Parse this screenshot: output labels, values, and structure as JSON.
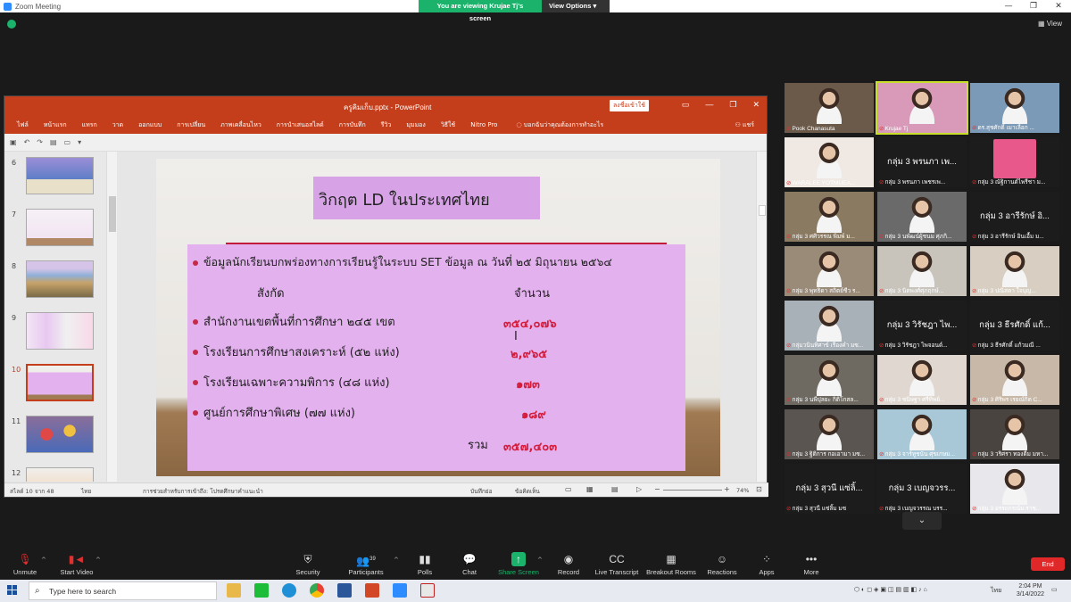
{
  "window": {
    "title": "Zoom Meeting",
    "controls": [
      "—",
      "❐",
      "✕"
    ],
    "viewing_banner": "You are viewing Krujae Tj's screen",
    "view_options": "View Options ▾",
    "view_button": "View"
  },
  "powerpoint": {
    "filename": "ครูคิมเก็บ.pptx  -  PowerPoint",
    "signin": "ลงชื่อเข้าใช้",
    "ribbon_tabs": [
      "ไฟล์",
      "หน้าแรก",
      "แทรก",
      "วาด",
      "ออกแบบ",
      "การเปลี่ยน",
      "ภาพเคลื่อนไหว",
      "การนำเสนอสไลด์",
      "การบันทึก",
      "รีวิว",
      "มุมมอง",
      "วิธีใช้",
      "Nitro Pro"
    ],
    "tell_me": "บอกฉันว่าคุณต้องการทำอะไร",
    "share": "แชร์",
    "thumbnails": [
      {
        "num": "6",
        "active": false
      },
      {
        "num": "7",
        "active": false
      },
      {
        "num": "8",
        "active": false
      },
      {
        "num": "9",
        "active": false
      },
      {
        "num": "10",
        "active": true
      },
      {
        "num": "11",
        "active": false
      },
      {
        "num": "12",
        "active": false
      }
    ],
    "slide": {
      "title": "วิกฤต LD ในประเทศไทย",
      "intro": "ข้อมูลนักเรียนบกพร่องทางการเรียนรู้ในระบบ SET ข้อมูล ณ วันที่ ๒๕ มิถุนายน ๒๕๖๔",
      "col_affiliation": "สังกัด",
      "col_count": "จำนวน",
      "rows": [
        {
          "label": "สำนักงานเขตพื้นที่การศึกษา ๒๔๕ เขต",
          "value": "๓๕๔,๐๗๖"
        },
        {
          "label": "โรงเรียนการศึกษาสงเคราะห์ (๕๒ แห่ง)",
          "value": "๒,๙๖๕"
        },
        {
          "label": "โรงเรียนเฉพาะความพิการ (๔๘ แห่ง)",
          "value": "๑๗๓"
        },
        {
          "label": "ศูนย์การศึกษาพิเศษ (๗๗ แห่ง)",
          "value": "๑๘๙"
        }
      ],
      "total_label": "รวม",
      "total_value": "๓๕๗,๔๐๓"
    },
    "status": {
      "slide_of": "สไลด์ 10 จาก 48",
      "language": "ไทย",
      "accessibility": "การช่วยสำหรับการเข้าถึง: โปรดศึกษาคำแนะนำ",
      "notes": "บันทึกย่อ",
      "comments": "ข้อคิดเห็น",
      "zoom": "74%"
    }
  },
  "participants": [
    {
      "name": "Pook Chanasuta",
      "type": "video",
      "color": "#6b5a4a"
    },
    {
      "name": "Krujae Tj",
      "type": "video",
      "color": "#d89ab8",
      "speaking": true
    },
    {
      "name": "ดร.สุชศักดิ์ เมาเลือก ...",
      "type": "video",
      "color": "#7a9ab8"
    },
    {
      "name": "WARALEE YOTMUEA...",
      "type": "video",
      "color": "#efe8e3"
    },
    {
      "name": "กลุ่ม 3 พรนภา เพชรเพ...",
      "type": "name",
      "big": "กลุ่ม 3 พรนภา เพ..."
    },
    {
      "name": "กลุ่ม 3 ณัฐิกานต์ไพรีชา ม...",
      "type": "avatar",
      "color": "#e8588a"
    },
    {
      "name": "กลุ่ม 3 ศศิวรรณ พิมพ์ ม...",
      "type": "video",
      "color": "#8a7a62"
    },
    {
      "name": "กลุ่ม 3 นพัฒน์ผู้ชนม ศุภกิ...",
      "type": "video",
      "color": "#6a6a6a"
    },
    {
      "name": "กลุ่ม 3 อารีรักษ์ อินเอื้ม ม...",
      "type": "name",
      "big": "กลุ่ม 3 อารีรักษ์ อิ..."
    },
    {
      "name": "กลุ่ม 3 พุทธิดา สถิตย์ชีว ร...",
      "type": "video",
      "color": "#9a8a78"
    },
    {
      "name": "กลุ่ม 3 นิตพงศ์ศุภฤกษ์...",
      "type": "video",
      "color": "#c8c4bc"
    },
    {
      "name": "กลุ่ม 3 ปณิสตา ใจบุญ...",
      "type": "video",
      "color": "#d8cfc2"
    },
    {
      "name": "กลุ่มวนินทิศาข์ เรืองคำ มซ...",
      "type": "video",
      "color": "#a8b0b8"
    },
    {
      "name": "กลุ่ม 3 วิรัชฎา ไพจอนด์...",
      "type": "name",
      "big": "กลุ่ม 3 วิรัชฎา ไพ..."
    },
    {
      "name": "กลุ่ม 3 ธีรศักดิ์ แก้วมณี ...",
      "type": "name",
      "big": "กลุ่ม 3 ธีรศักดิ์ แก้..."
    },
    {
      "name": "กลุ่ม 3 นพีปุลยะ กิติโกสล...",
      "type": "video",
      "color": "#6e6a62"
    },
    {
      "name": "กลุ่ม 3 ชนิษฐา ศรีทิพย์...",
      "type": "video",
      "color": "#e0d8d0"
    },
    {
      "name": "กลุ่ม 3 ศิริพร เรยณ์กิต C...",
      "type": "video",
      "color": "#c8b8a8"
    },
    {
      "name": "กลุ่ม 3 ฐิติการ กอเอามา มซ...",
      "type": "video",
      "color": "#5a5550"
    },
    {
      "name": "กลุ่ม 3 จาร์ทูชนัน ศุขเกษม...",
      "type": "video",
      "color": "#a8c8d8"
    },
    {
      "name": "กลุ่ม 3 วริศรา ทองดีม มหา...",
      "type": "video",
      "color": "#4a4440"
    },
    {
      "name": "กลุ่ม 3 สุวนี แซ่ลิ้ม มซ",
      "type": "name",
      "big": "กลุ่ม 3 สุวนี แซ่ลิ้..."
    },
    {
      "name": "กลุ่ม 3 เบญจวรรณ บรร...",
      "type": "name",
      "big": "กลุ่ม 3 เบญจวรร..."
    },
    {
      "name": "กลุ่ม 3 อรรถกรณ์ม.ราช...",
      "type": "video",
      "color": "#e8e8ec"
    }
  ],
  "toolbar": {
    "unmute": "Unmute",
    "start_video": "Start Video",
    "security": "Security",
    "participants": "Participants",
    "participants_count": "39",
    "polls": "Polls",
    "chat": "Chat",
    "share_screen": "Share Screen",
    "record": "Record",
    "live_transcript": "Live Transcript",
    "breakout_rooms": "Breakout Rooms",
    "reactions": "Reactions",
    "apps": "Apps",
    "more": "More",
    "end": "End"
  },
  "taskbar": {
    "search_placeholder": "Type here to search",
    "language": "ไทย",
    "time": "2:04 PM",
    "date": "3/14/2022"
  }
}
